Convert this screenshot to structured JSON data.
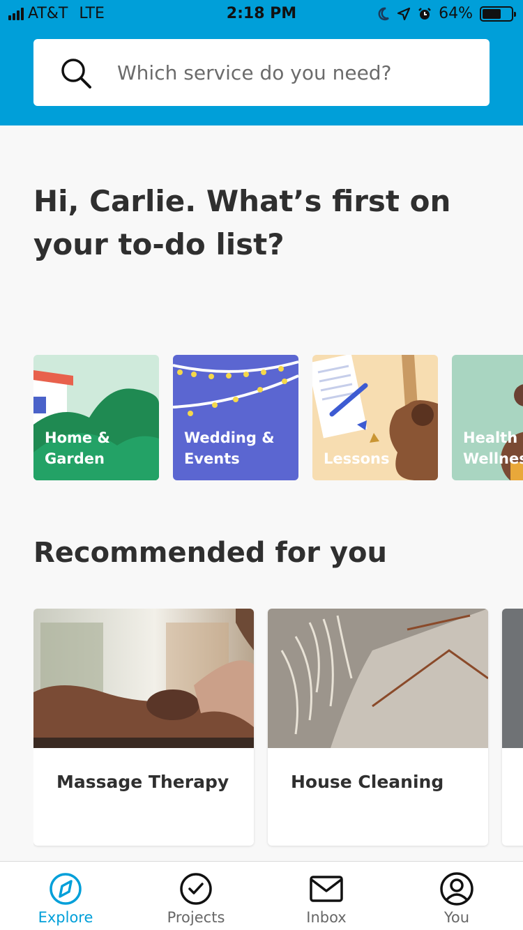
{
  "status_bar": {
    "carrier": "AT&T",
    "network": "LTE",
    "time": "2:18 PM",
    "battery": "64%",
    "battery_level": 0.64
  },
  "search": {
    "placeholder": "Which service do you need?"
  },
  "greeting": "Hi, Carlie. What’s first on your to-do list?",
  "categories": [
    {
      "label": "Home &\nGarden"
    },
    {
      "label": "Wedding &\nEvents"
    },
    {
      "label": "Lessons"
    },
    {
      "label": "Health &\nWellness"
    }
  ],
  "recommended": {
    "title": "Recommended for you",
    "items": [
      {
        "title": "Massage Therapy"
      },
      {
        "title": "House Cleaning"
      }
    ]
  },
  "tab_bar": {
    "tabs": [
      {
        "label": "Explore",
        "icon": "compass-icon",
        "active": true
      },
      {
        "label": "Projects",
        "icon": "check-circle-icon",
        "active": false
      },
      {
        "label": "Inbox",
        "icon": "envelope-icon",
        "active": false
      },
      {
        "label": "You",
        "icon": "user-icon",
        "active": false
      }
    ]
  },
  "colors": {
    "brand": "#009fd9",
    "text": "#2f2f2f",
    "tab_inactive": "#676767"
  }
}
